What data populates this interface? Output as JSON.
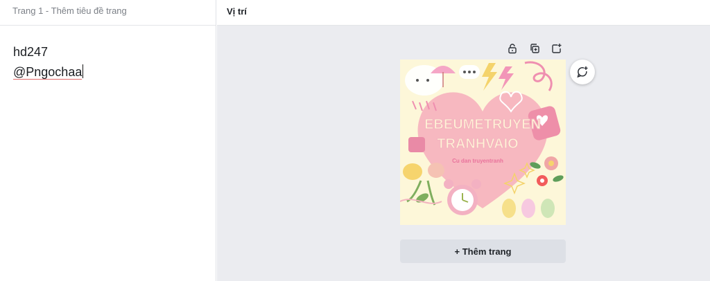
{
  "left": {
    "page_heading": "Trang 1 - Thêm tiêu đề trang",
    "lines": [
      "hd247",
      "@Pngochaa"
    ]
  },
  "right": {
    "title": "Vị trí",
    "add_page_label": "+ Thêm trang"
  },
  "thumbnail": {
    "title_line1": "EBEUMETRUYEN",
    "title_line2": "TRANHVAIO",
    "subtitle": "Cu dan truyentranh"
  },
  "icons": [
    "lock-icon",
    "duplicate-icon",
    "add-page-icon",
    "add-comment-icon"
  ],
  "colors": {
    "canvas_bg": "#ebecf0",
    "button_bg": "#dde0e6",
    "thumb_bg": "#fdf7d9",
    "heart": "#f7b8c0",
    "accent_pink": "#ef8fb0"
  }
}
